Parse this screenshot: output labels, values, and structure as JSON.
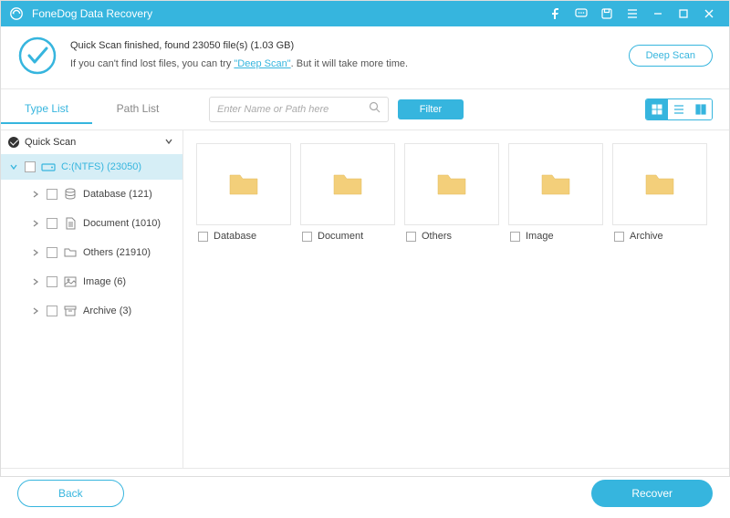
{
  "app": {
    "title": "FoneDog Data Recovery"
  },
  "banner": {
    "line1": "Quick Scan finished, found 23050 file(s) (1.03 GB)",
    "line2_prefix": "If you can't find lost files, you can try ",
    "line2_link": "\"Deep Scan\"",
    "line2_suffix": ". But it will take more time.",
    "deepscan_button": "Deep Scan"
  },
  "tabs": {
    "type_list": "Type List",
    "path_list": "Path List"
  },
  "search": {
    "placeholder": "Enter Name or Path here"
  },
  "filter_label": "Filter",
  "tree": {
    "root_label": "Quick Scan",
    "drive_label": "C:(NTFS) (23050)",
    "children": [
      {
        "label": "Database (121)",
        "icon": "database"
      },
      {
        "label": "Document (1010)",
        "icon": "document"
      },
      {
        "label": "Others (21910)",
        "icon": "folder"
      },
      {
        "label": "Image (6)",
        "icon": "image"
      },
      {
        "label": "Archive (3)",
        "icon": "archive"
      }
    ]
  },
  "tiles": [
    {
      "label": "Database"
    },
    {
      "label": "Document"
    },
    {
      "label": "Others"
    },
    {
      "label": "Image"
    },
    {
      "label": "Archive"
    }
  ],
  "footer": {
    "back": "Back",
    "recover": "Recover"
  }
}
